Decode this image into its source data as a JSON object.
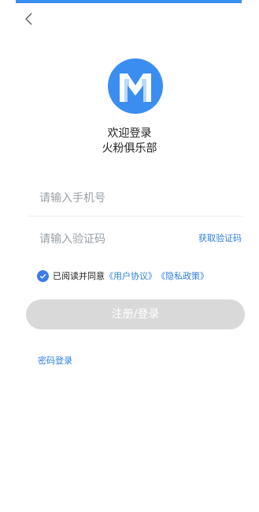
{
  "header": {
    "welcome_line1": "欢迎登录",
    "welcome_line2": "火粉俱乐部"
  },
  "form": {
    "phone_placeholder": "请输入手机号",
    "code_placeholder": "请输入验证码",
    "get_code_label": "获取验证码",
    "agreement_prefix": "已阅读并同意",
    "user_agreement": "《用户协议》",
    "privacy_policy": "《隐私政策》",
    "submit_label": "注册/登录",
    "password_login_label": "密码登录"
  },
  "colors": {
    "accent": "#3a8ef0",
    "link": "#2f7fe0",
    "button_disabled": "#d9d9d9"
  },
  "icons": {
    "back": "chevron-left-icon",
    "logo": "app-logo",
    "checkbox": "check-circle-icon"
  }
}
